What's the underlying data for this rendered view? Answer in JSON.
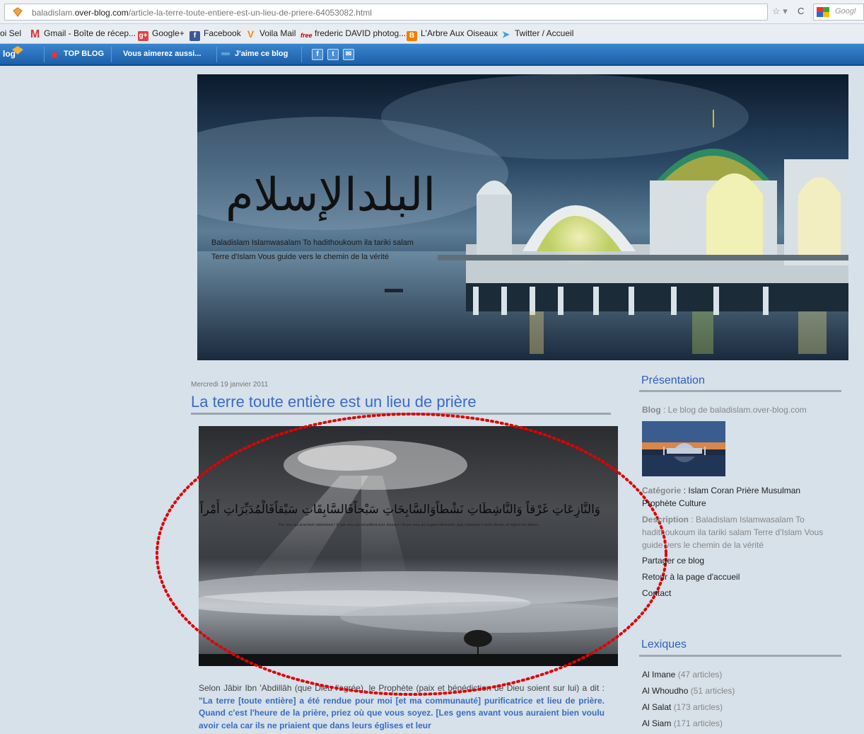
{
  "browser": {
    "url_prefix": "baladislam.",
    "url_domain": "over-blog.com",
    "url_path": "/article-la-terre-toute-entiere-est-un-lieu-de-priere-64053082.html",
    "search_placeholder": "Googl"
  },
  "bookmarks": [
    {
      "label": "oi Sel",
      "icon": "none"
    },
    {
      "label": "Gmail - Boîte de récep...",
      "icon": "gmail-icon"
    },
    {
      "label": "Google+",
      "icon": "google-plus-icon"
    },
    {
      "label": "Facebook",
      "icon": "facebook-icon"
    },
    {
      "label": "Voila Mail",
      "icon": "voila-icon"
    },
    {
      "label": "frederic DAVID photog...",
      "icon": "free-icon"
    },
    {
      "label": "L'Arbre Aux Oiseaux",
      "icon": "blogger-icon"
    },
    {
      "label": "Twitter / Accueil",
      "icon": "twitter-icon"
    }
  ],
  "toolbar": {
    "logo": "log",
    "top_blog": "TOP BLOG",
    "vous_aimerez": "Vous aimerez aussi...",
    "jaime": "J'aime ce blog",
    "share_buttons": [
      "f",
      "t",
      "✉"
    ]
  },
  "banner": {
    "title_ar": "البلدالإسلام",
    "subtitle_line1": "Baladislam Islamwasalam To hadithoukoum ila tariki salam",
    "subtitle_line2": "Terre d'Islam Vous guide vers le chemin de la vérité"
  },
  "post": {
    "date": "Mercredi 19 janvier 2011",
    "title": "La terre toute entière est un lieu de prière",
    "image_verse_ar": "وَالنَّازِعَاتِ غَرْقاً وَالنَّاشِطَاتِ نَشْطاًوَالسَّابِحَاتِ سَبْحاًفَالسَّابِقَاتِ سَبْقاًفَالْمُدَبِّرَاتِ أَمْراً",
    "image_verse_fr": "Par ceux qui arrachent violemment ! Et par ceux qui recueillent avec douceur ! Et par ceux qui voguent librement, puis s'élancent à toute vitesse, et règlent les affaires",
    "body_intro": "Selon Jâbir Ibn 'Abdillâh (que Dieu l'agrée), le Prophète (paix et bénédiction de Dieu soient sur lui) a dit : ",
    "body_quote": "\"La terre [toute entière] a été rendue pour moi [et ma communauté] purificatrice et lieu de prière. Quand c'est l'heure de la prière, priez où que vous soyez. [Les gens avant vous auraient bien voulu avoir cela car ils ne priaient que dans leurs églises et leur"
  },
  "sidebar": {
    "presentation_heading": "Présentation",
    "blog_label": "Blog",
    "blog_value": " : Le blog de baladislam.over-blog.com",
    "categorie_label": "Catégorie",
    "categorie_value": " : Islam Coran Prière Musulman",
    "categorie_value2": "Prophète Culture",
    "description_label": "Description",
    "description_value1": " : Baladislam Islamwasalam To",
    "description_value2": "hadithoukoum ila tariki salam Terre d'Islam Vous",
    "description_value3": "guide vers le chemin de la vérité",
    "links": [
      "Partager ce blog",
      "Retour à la page d'accueil",
      "Contact"
    ],
    "lexiques_heading": "Lexiques",
    "lexiques": [
      {
        "name": "Al Imane",
        "count": "(47 articles)"
      },
      {
        "name": "Al Whoudho",
        "count": "(51 articles)"
      },
      {
        "name": "Al Salat",
        "count": "(173 articles)"
      },
      {
        "name": "Al Siam",
        "count": "(171 articles)"
      }
    ]
  },
  "colors": {
    "link_blue": "#3b6ac9",
    "toolbar_blue": "#2a72bd",
    "annotation_red": "#e00000",
    "page_bg": "#d6e1ea"
  }
}
